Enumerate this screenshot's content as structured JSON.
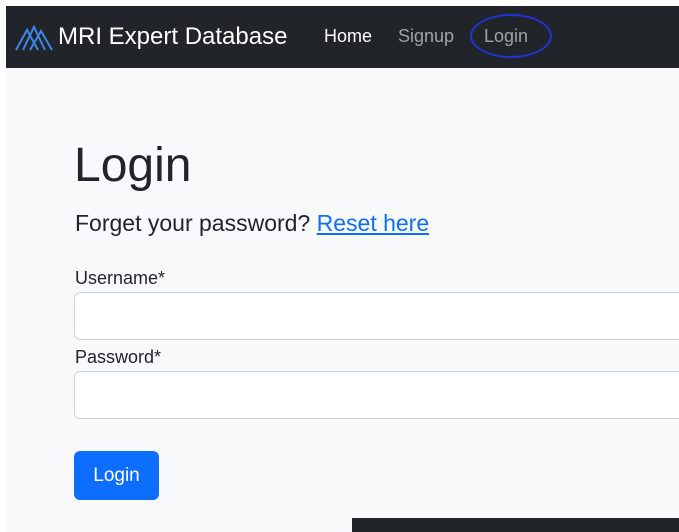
{
  "navbar": {
    "brand": "MRI Expert Database",
    "links": [
      {
        "label": "Home"
      },
      {
        "label": "Signup"
      },
      {
        "label": "Login"
      }
    ]
  },
  "main": {
    "title": "Login",
    "forgot_text": "Forget your password?",
    "reset_link": "Reset here",
    "username_label": "Username*",
    "password_label": "Password*",
    "login_button": "Login"
  },
  "colors": {
    "navbar_bg": "#212529",
    "primary": "#0d6efd",
    "highlight_ring": "#1f33d8",
    "logo": "#3d86ea"
  }
}
